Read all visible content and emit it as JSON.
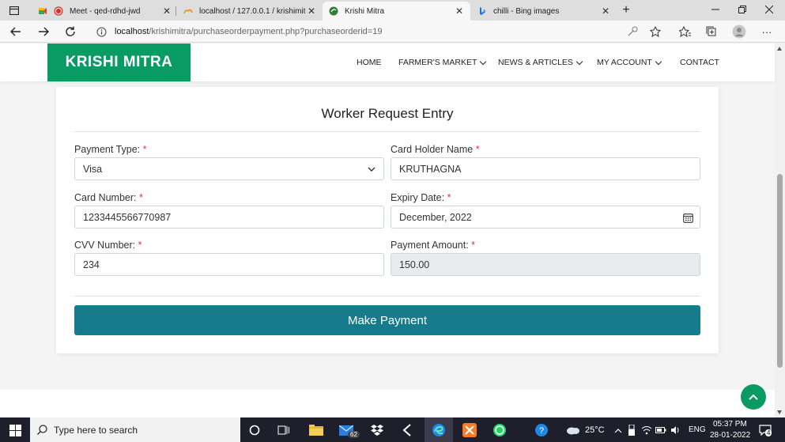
{
  "browser": {
    "tabs": [
      {
        "title": "Meet - qed-rdhd-jwd",
        "active": false
      },
      {
        "title": "localhost / 127.0.0.1 / krishimitra",
        "active": false
      },
      {
        "title": "Krishi Mitra",
        "active": true
      },
      {
        "title": "chilli - Bing images",
        "active": false
      }
    ],
    "new_tab": "+",
    "url_host": "localhost",
    "url_path": "/krishimitra/purchaseorderpayment.php?purchaseorderid=19"
  },
  "site": {
    "logo": "KRISHI MITRA",
    "nav": {
      "home": "HOME",
      "market": "FARMER'S MARKET",
      "news": "NEWS & ARTICLES",
      "account": "MY ACCOUNT",
      "contact": "CONTACT"
    }
  },
  "form": {
    "title": "Worker Request Entry",
    "payment_type": {
      "label": "Payment Type:",
      "value": "Visa"
    },
    "card_holder": {
      "label": "Card Holder Name",
      "value": "KRUTHAGNA"
    },
    "card_number": {
      "label": "Card Number:",
      "value": "1233445566770987"
    },
    "expiry": {
      "label": "Expiry Date:",
      "value": "December, 2022"
    },
    "cvv": {
      "label": "CVV Number:",
      "value": "234"
    },
    "amount": {
      "label": "Payment Amount:",
      "value": "150.00"
    },
    "required_mark": "*",
    "submit": "Make Payment"
  },
  "taskbar": {
    "search_placeholder": "Type here to search",
    "mail_badge": "62",
    "weather": "25°C",
    "lang": "ENG",
    "time": "05:37 PM",
    "date": "28-01-2022",
    "notif_badge": "4"
  },
  "colors": {
    "brand_green": "#0a9a63",
    "button_teal": "#177b8e",
    "required_red": "#dc3545"
  }
}
